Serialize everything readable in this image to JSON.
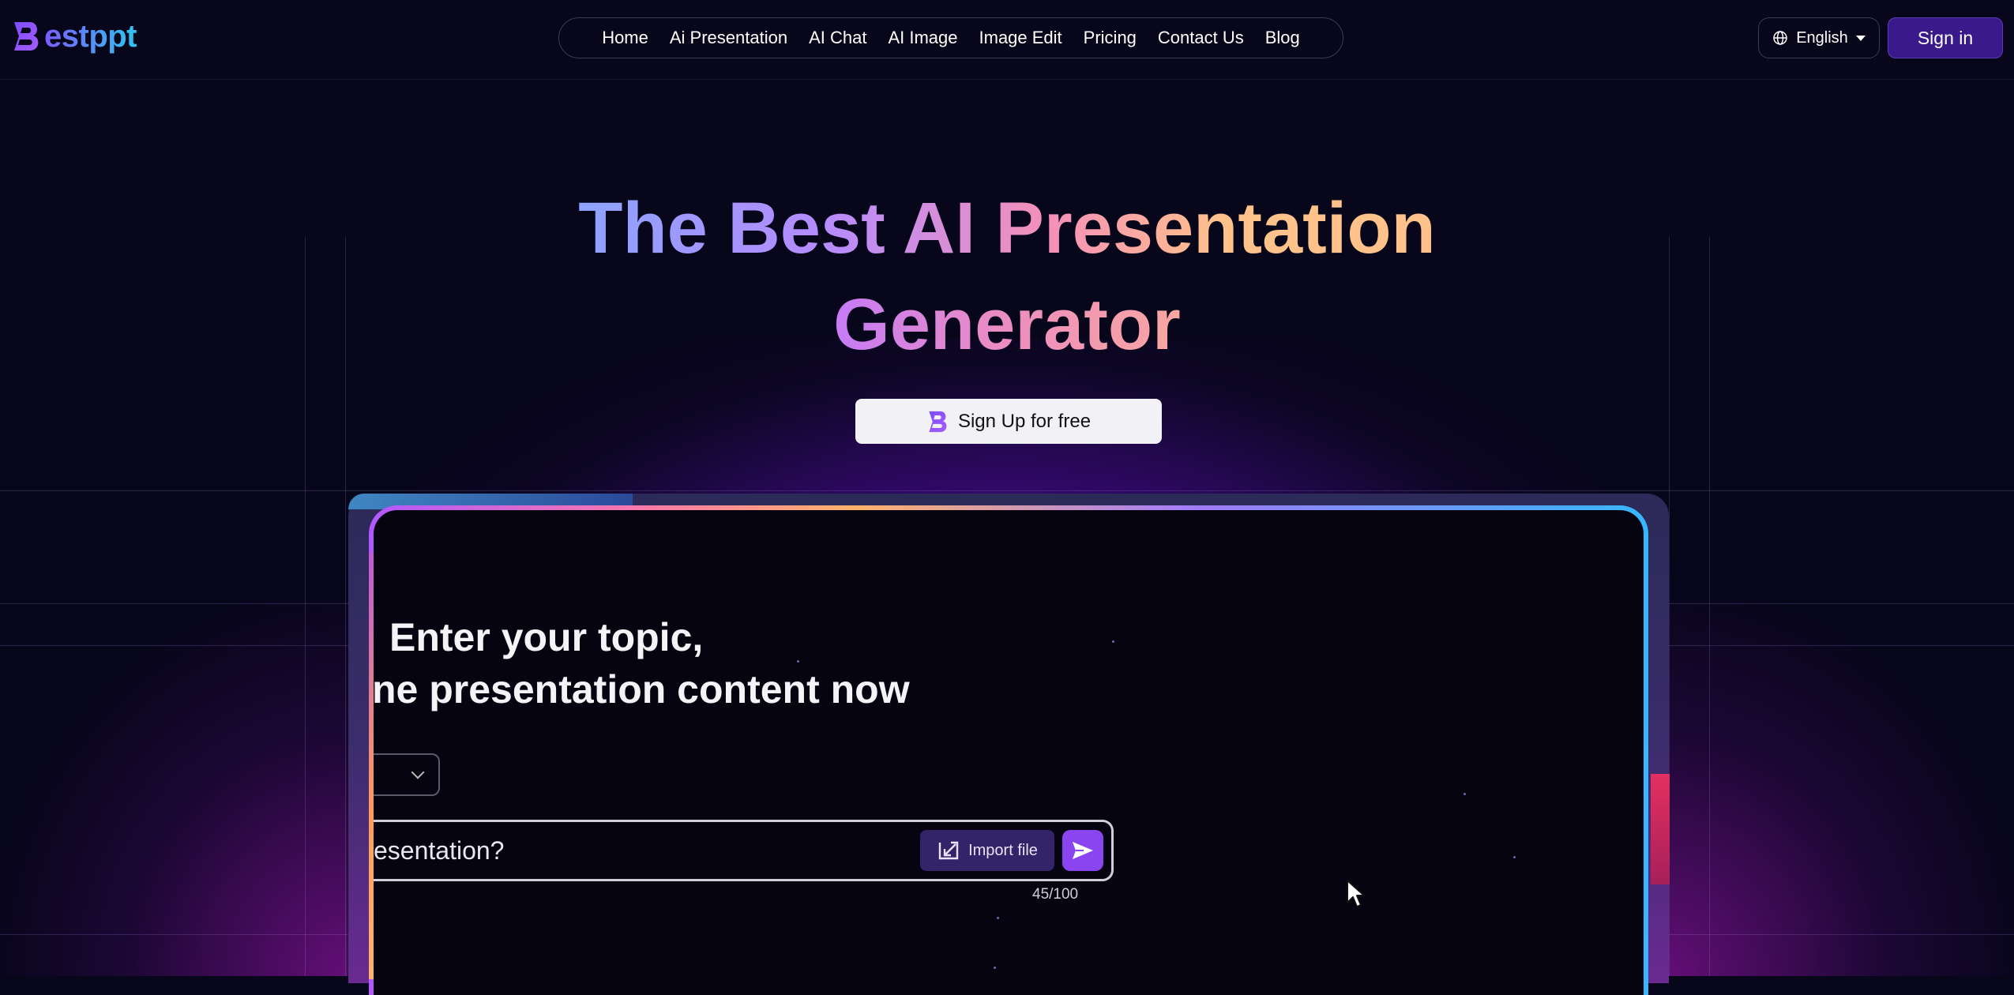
{
  "brand": {
    "name": "estppt",
    "logo_letter": "B"
  },
  "nav": {
    "links": [
      "Home",
      "Ai Presentation",
      "AI Chat",
      "AI Image",
      "Image Edit",
      "Pricing",
      "Contact Us",
      "Blog"
    ],
    "language": "English",
    "sign_in": "Sign in"
  },
  "hero": {
    "title_line1": "The Best AI Presentation",
    "title_line2": "Generator",
    "cta": "Sign Up for free"
  },
  "demo": {
    "heading_line1": "Enter your topic,",
    "heading_line2": "ne presentation content now",
    "input_value": "esentation?",
    "import_label": "Import file",
    "char_count": "45/100"
  },
  "colors": {
    "background": "#07061a",
    "accent_purple": "#8a45f0",
    "signin_bg": "#3a1a8a"
  }
}
